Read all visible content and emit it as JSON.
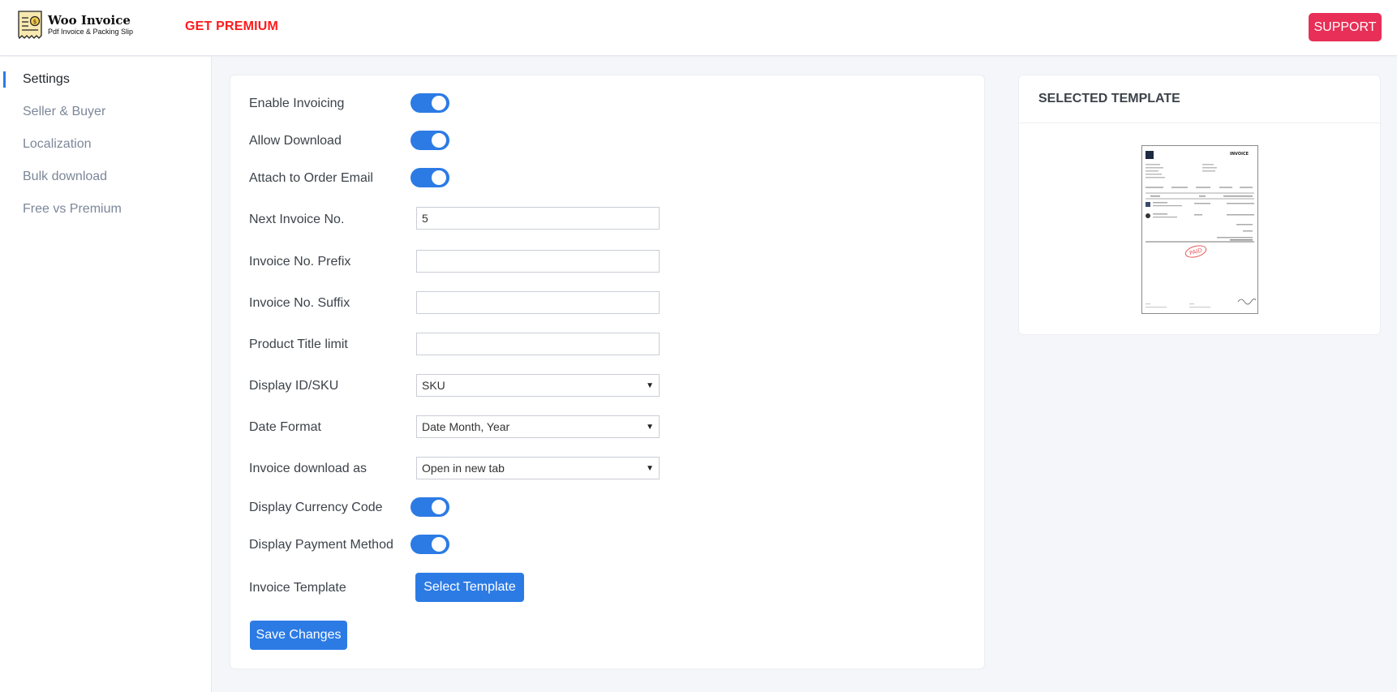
{
  "brand": {
    "title": "Woo Invoice",
    "subtitle": "Pdf Invoice & Packing Slip",
    "premium_label": "GET PREMIUM",
    "support_label": "SUPPORT",
    "premium_color": "#ff1a1a",
    "support_color": "#e72f57"
  },
  "sidebar": {
    "items": [
      {
        "label": "Settings",
        "active": true
      },
      {
        "label": "Seller & Buyer",
        "active": false
      },
      {
        "label": "Localization",
        "active": false
      },
      {
        "label": "Bulk download",
        "active": false
      },
      {
        "label": "Free vs Premium",
        "active": false
      }
    ]
  },
  "settings": {
    "enable_invoicing": {
      "label": "Enable Invoicing",
      "enabled": true
    },
    "allow_download": {
      "label": "Allow Download",
      "enabled": true
    },
    "attach_email": {
      "label": "Attach to Order Email",
      "enabled": true
    },
    "next_invoice_no": {
      "label": "Next Invoice No.",
      "value": "5"
    },
    "invoice_prefix": {
      "label": "Invoice No. Prefix",
      "value": ""
    },
    "invoice_suffix": {
      "label": "Invoice No. Suffix",
      "value": ""
    },
    "title_limit": {
      "label": "Product Title limit",
      "value": ""
    },
    "display_id_sku": {
      "label": "Display ID/SKU",
      "value": "SKU"
    },
    "date_format": {
      "label": "Date Format",
      "value": "Date Month, Year"
    },
    "download_as": {
      "label": "Invoice download as",
      "value": "Open in new tab"
    },
    "currency_code": {
      "label": "Display Currency Code",
      "enabled": true
    },
    "payment_method": {
      "label": "Display Payment Method",
      "enabled": true
    },
    "invoice_template": {
      "label": "Invoice Template",
      "button": "Select Template"
    },
    "save_label": "Save Changes",
    "accent_color": "#2c7be5"
  },
  "template_panel": {
    "title": "SELECTED TEMPLATE",
    "preview": {
      "heading": "INVOICE",
      "stamp": "PAID"
    }
  }
}
